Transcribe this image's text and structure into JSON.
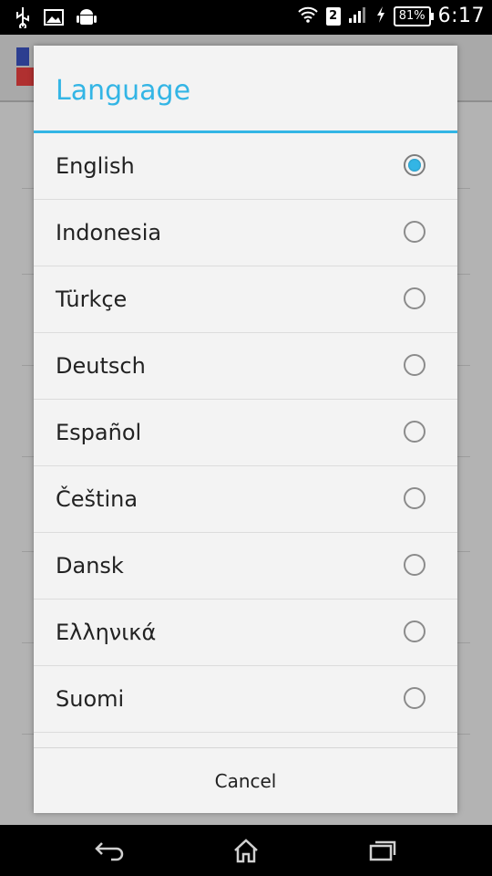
{
  "status_bar": {
    "left_icons": [
      "usb-icon",
      "image-icon",
      "android-icon"
    ],
    "sim_badge": "2",
    "battery": "81%",
    "time": "6:17"
  },
  "dialog": {
    "title": "Language",
    "options": [
      {
        "label": "English",
        "selected": true
      },
      {
        "label": "Indonesia",
        "selected": false
      },
      {
        "label": "Türkçe",
        "selected": false
      },
      {
        "label": "Deutsch",
        "selected": false
      },
      {
        "label": "Español",
        "selected": false
      },
      {
        "label": "Čeština",
        "selected": false
      },
      {
        "label": "Dansk",
        "selected": false
      },
      {
        "label": "Ελληνικά",
        "selected": false
      },
      {
        "label": "Suomi",
        "selected": false
      }
    ],
    "cancel_label": "Cancel"
  },
  "accent_color": "#33b5e5",
  "nav_bar": {
    "buttons": [
      "back-icon",
      "home-icon",
      "recents-icon"
    ]
  }
}
